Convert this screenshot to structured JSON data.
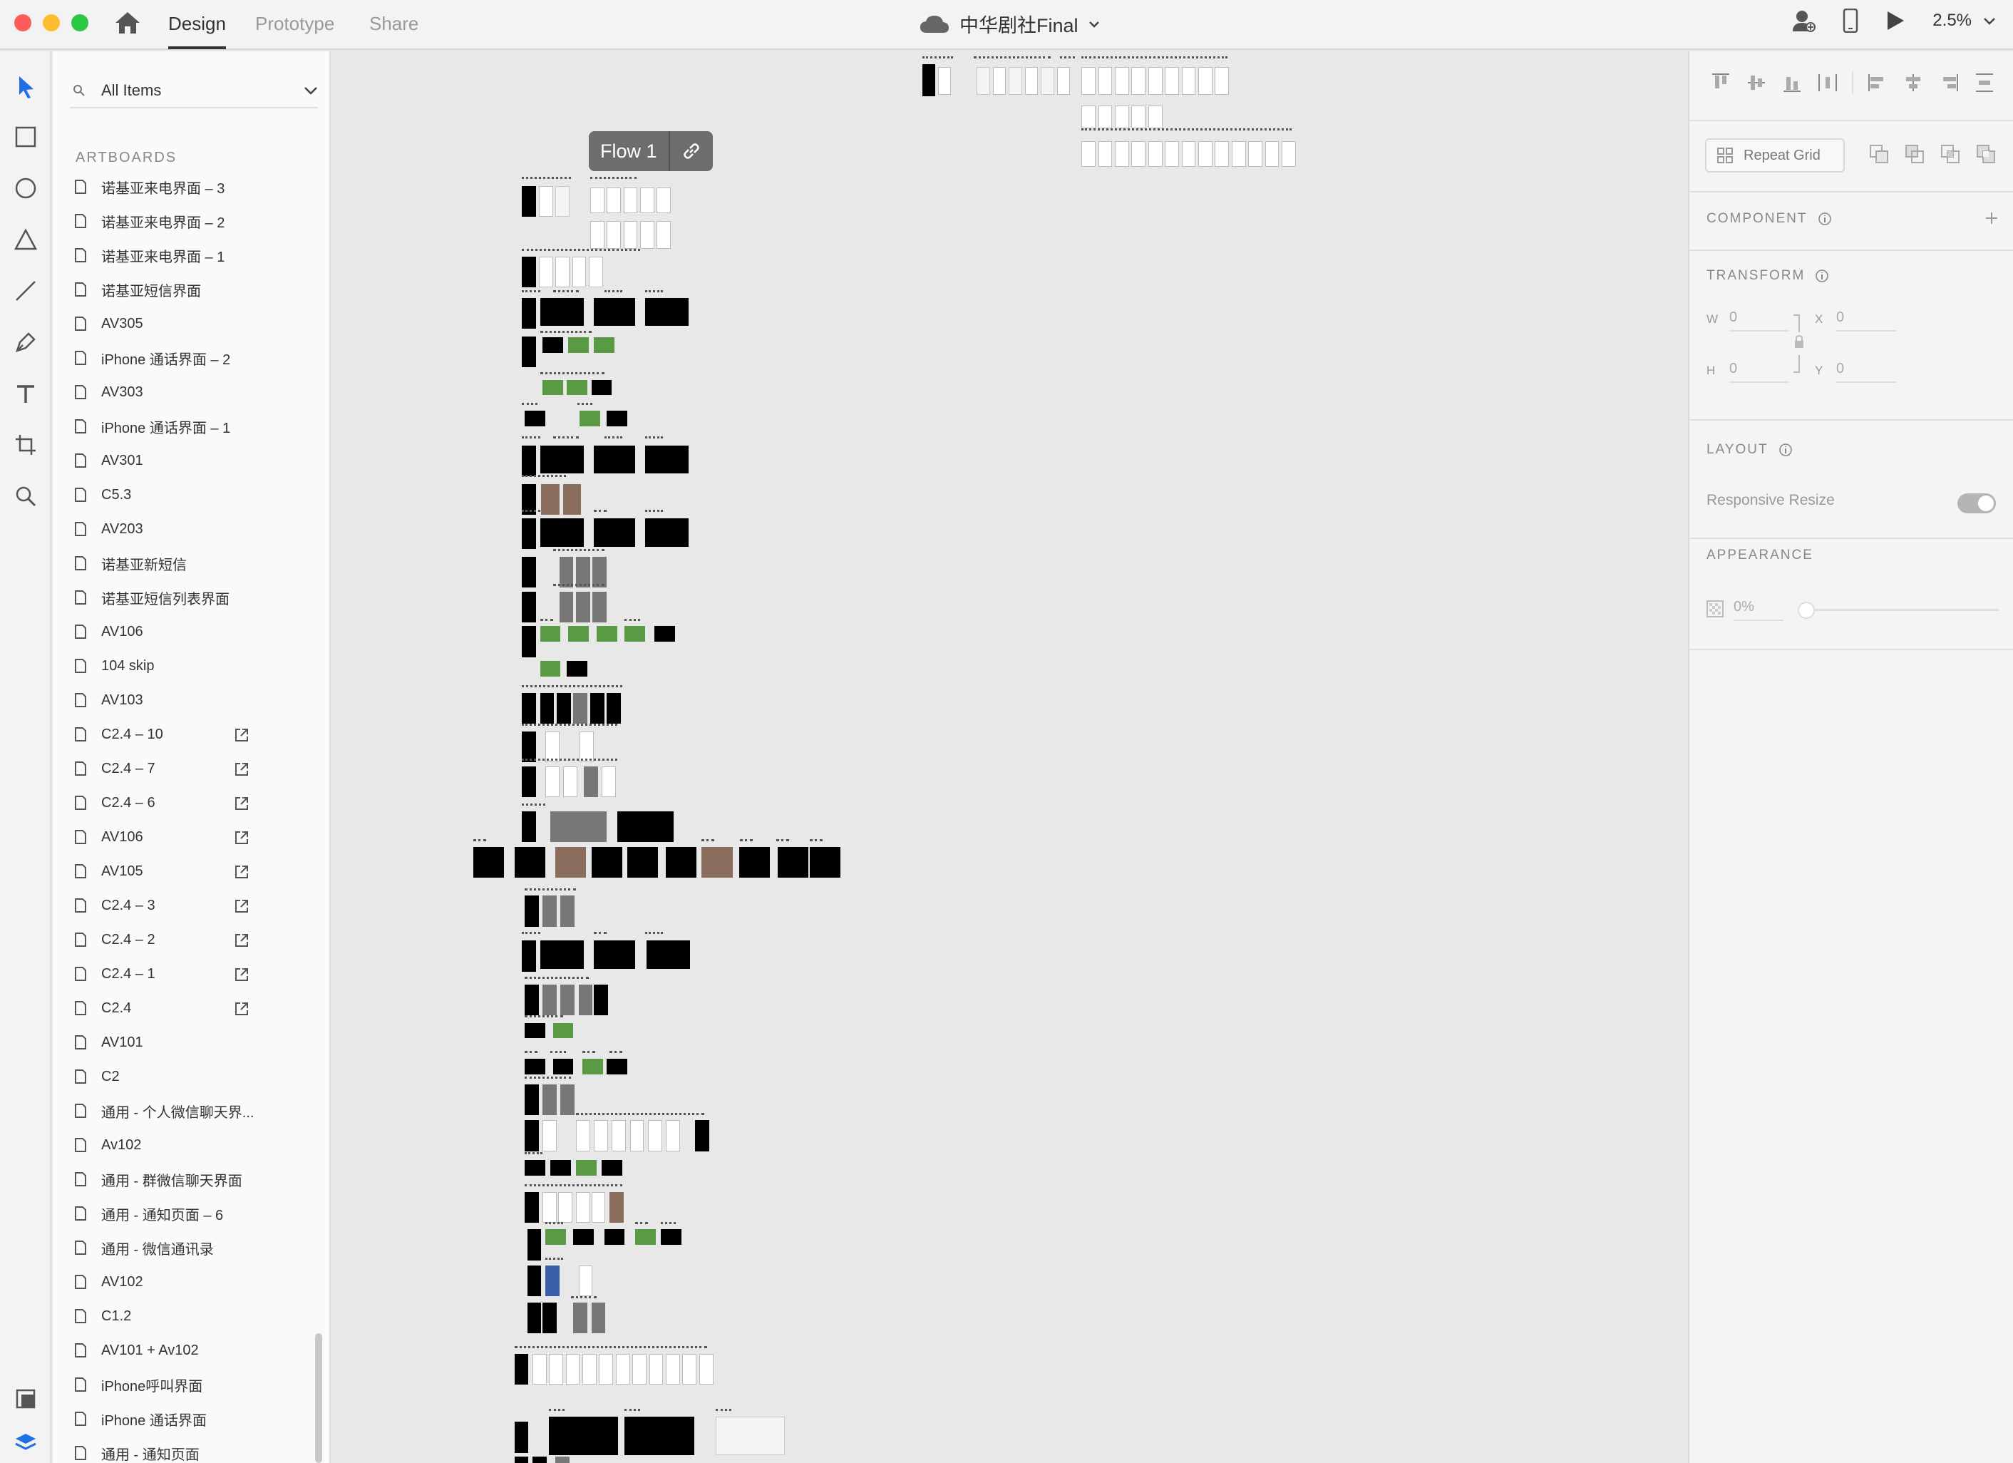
{
  "header": {
    "tabs": [
      {
        "label": "Design",
        "active": true
      },
      {
        "label": "Prototype",
        "active": false
      },
      {
        "label": "Share",
        "active": false
      }
    ],
    "doc_title": "中华剧社Final",
    "zoom": "2.5%"
  },
  "layers": {
    "search_label": "All Items",
    "section": "ARTBOARDS",
    "items": [
      {
        "label": "诺基亚来电界面 – 3",
        "shared": false
      },
      {
        "label": "诺基亚来电界面 – 2",
        "shared": false
      },
      {
        "label": "诺基亚来电界面 – 1",
        "shared": false
      },
      {
        "label": "诺基亚短信界面",
        "shared": false
      },
      {
        "label": "AV305",
        "shared": false
      },
      {
        "label": "iPhone 通话界面 – 2",
        "shared": false
      },
      {
        "label": "AV303",
        "shared": false
      },
      {
        "label": "iPhone 通话界面 – 1",
        "shared": false
      },
      {
        "label": "AV301",
        "shared": false
      },
      {
        "label": "C5.3",
        "shared": false
      },
      {
        "label": "AV203",
        "shared": false
      },
      {
        "label": "诺基亚新短信",
        "shared": false
      },
      {
        "label": "诺基亚短信列表界面",
        "shared": false
      },
      {
        "label": "AV106",
        "shared": false
      },
      {
        "label": "104 skip",
        "shared": false
      },
      {
        "label": "AV103",
        "shared": false
      },
      {
        "label": "C2.4 – 10",
        "shared": true
      },
      {
        "label": "C2.4 – 7",
        "shared": true
      },
      {
        "label": "C2.4 – 6",
        "shared": true
      },
      {
        "label": "AV106",
        "shared": true
      },
      {
        "label": "AV105",
        "shared": true
      },
      {
        "label": "C2.4 – 3",
        "shared": true
      },
      {
        "label": "C2.4 – 2",
        "shared": true
      },
      {
        "label": "C2.4 – 1",
        "shared": true
      },
      {
        "label": "C2.4",
        "shared": true
      },
      {
        "label": "AV101",
        "shared": false
      },
      {
        "label": "C2",
        "shared": false
      },
      {
        "label": "通用 - 个人微信聊天界...",
        "shared": false
      },
      {
        "label": "Av102",
        "shared": false
      },
      {
        "label": "通用 - 群微信聊天界面",
        "shared": false
      },
      {
        "label": "通用 - 通知页面 – 6",
        "shared": false
      },
      {
        "label": "通用 - 微信通讯录",
        "shared": false
      },
      {
        "label": "AV102",
        "shared": false
      },
      {
        "label": "C1.2",
        "shared": false
      },
      {
        "label": "AV101 + Av102",
        "shared": false
      },
      {
        "label": "iPhone呼叫界面",
        "shared": false
      },
      {
        "label": "iPhone 通话界面",
        "shared": false
      },
      {
        "label": "通用 - 通知页面",
        "shared": false
      }
    ]
  },
  "canvas": {
    "flow_label": "Flow 1"
  },
  "inspector": {
    "repeat_grid": "Repeat Grid",
    "component": "COMPONENT",
    "transform": "TRANSFORM",
    "w_label": "W",
    "w_value": "0",
    "x_label": "X",
    "x_value": "0",
    "h_label": "H",
    "h_value": "0",
    "y_label": "Y",
    "y_value": "0",
    "layout": "LAYOUT",
    "responsive_resize": "Responsive Resize",
    "responsive_resize_on": true,
    "appearance": "APPEARANCE",
    "opacity": "0%"
  },
  "colors": {
    "accent": "#1f6fe5",
    "artboard_dark": "#000000",
    "artboard_green": "#5b9a45"
  }
}
